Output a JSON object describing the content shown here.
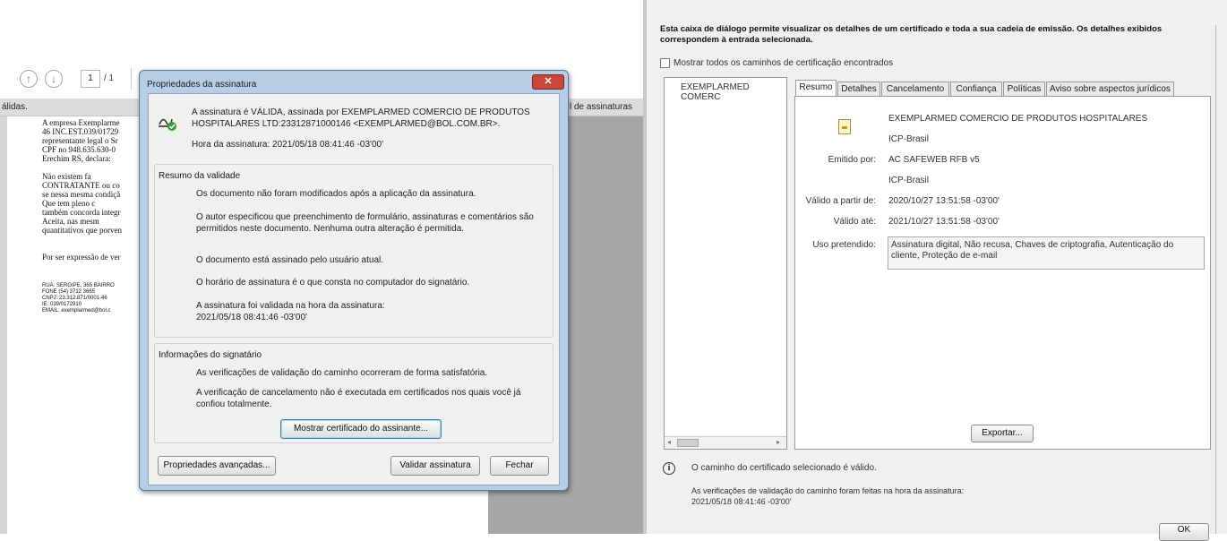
{
  "viewer": {
    "page_current": "1",
    "page_total": "/ 1",
    "sigbar_left": "álidas.",
    "sigbar_right": "l de assinaturas",
    "doc_lines": [
      "  A empresa Exemplarme",
      "46 INC.EST.039/01729",
      "representante legal o Sr",
      "CPF no 948.635.630-0",
      "Erechim RS, declara:",
      "",
      "      Não existem fa",
      "CONTRATANTE ou co",
      "se nessa mesma condiçã",
      "      Que tem pleno c",
      "também concorda integr",
      "      Aceita, nas mesm",
      "quantitativos que porven",
      "",
      "",
      "Por ser expressão de ver"
    ],
    "footer_lines": [
      "RUA: SERGIPE, 365 BAIRRO",
      "FONE (54) 3712 3665",
      "CNPJ: 23.312.871/0001-46",
      "IE: 039/0172910",
      "EMAIL: exemplarmed@bol.c"
    ]
  },
  "sig_dialog": {
    "title": "Propriedades da assinatura",
    "close": "✕",
    "status": "A assinatura é VÁLIDA, assinada por EXEMPLARMED COMERCIO DE PRODUTOS HOSPITALARES LTD:23312871000146 <EXEMPLARMED@BOL.COM.BR>.",
    "sign_time": "Hora da assinatura:  2021/05/18 08:41:46 -03'00'",
    "validity_title": "Resumo da validade",
    "validity_items": [
      "Os documento não foram modificados após a aplicação da assinatura.",
      "O autor especificou que preenchimento de formulário, assinaturas e comentários são permitidos neste documento. Nenhuma outra alteração é permitida.",
      "O documento está assinado pelo usuário atual.",
      "O horário de assinatura é o que consta no computador do signatário.",
      "A assinatura foi validada na hora da assinatura:\n2021/05/18 08:41:46 -03'00'"
    ],
    "signer_title": "Informações do signatário",
    "signer_items": [
      "As verificações de validação do caminho ocorreram de forma satisfatória.",
      "A verificação de cancelamento não é executada em certificados nos quais você já confiou totalmente."
    ],
    "show_cert": "Mostrar certificado do assinante...",
    "advanced": "Propriedades avançadas...",
    "validate": "Validar assinatura",
    "close_btn": "Fechar"
  },
  "cert": {
    "intro": "Esta caixa de diálogo permite visualizar os detalhes de um certificado e toda a sua cadeia de emissão. Os detalhes exibidos correspondem à entrada selecionada.",
    "show_all_paths": "Mostrar todos os caminhos de certificação encontrados",
    "tree_item": "EXEMPLARMED COMERC",
    "tabs": [
      "Resumo",
      "Detalhes",
      "Cancelamento",
      "Confiança",
      "Políticas",
      "Aviso sobre aspectos jurídicos"
    ],
    "subject": "EXEMPLARMED COMERCIO DE PRODUTOS HOSPITALARES",
    "subject_org": "ICP-Brasil",
    "issued_by_label": "Emitido por:",
    "issued_by": "AC SAFEWEB RFB v5",
    "issued_by_org": "ICP-Brasil",
    "valid_from_label": "Válido a partir de:",
    "valid_from": "2020/10/27 13:51:58 -03'00'",
    "valid_to_label": "Válido até:",
    "valid_to": "2021/10/27 13:51:58 -03'00'",
    "usage_label": "Uso pretendido:",
    "usage": "Assinatura digital, Não recusa, Chaves de criptografia, Autenticação do cliente, Proteção de e-mail",
    "export": "Exportar...",
    "path_valid": "O caminho do certificado selecionado é válido.",
    "path_checks": "As verificações de validação do caminho foram feitas na hora da assinatura:",
    "path_time": "2021/05/18 08:41:46 -03'00'",
    "ok": "OK"
  }
}
